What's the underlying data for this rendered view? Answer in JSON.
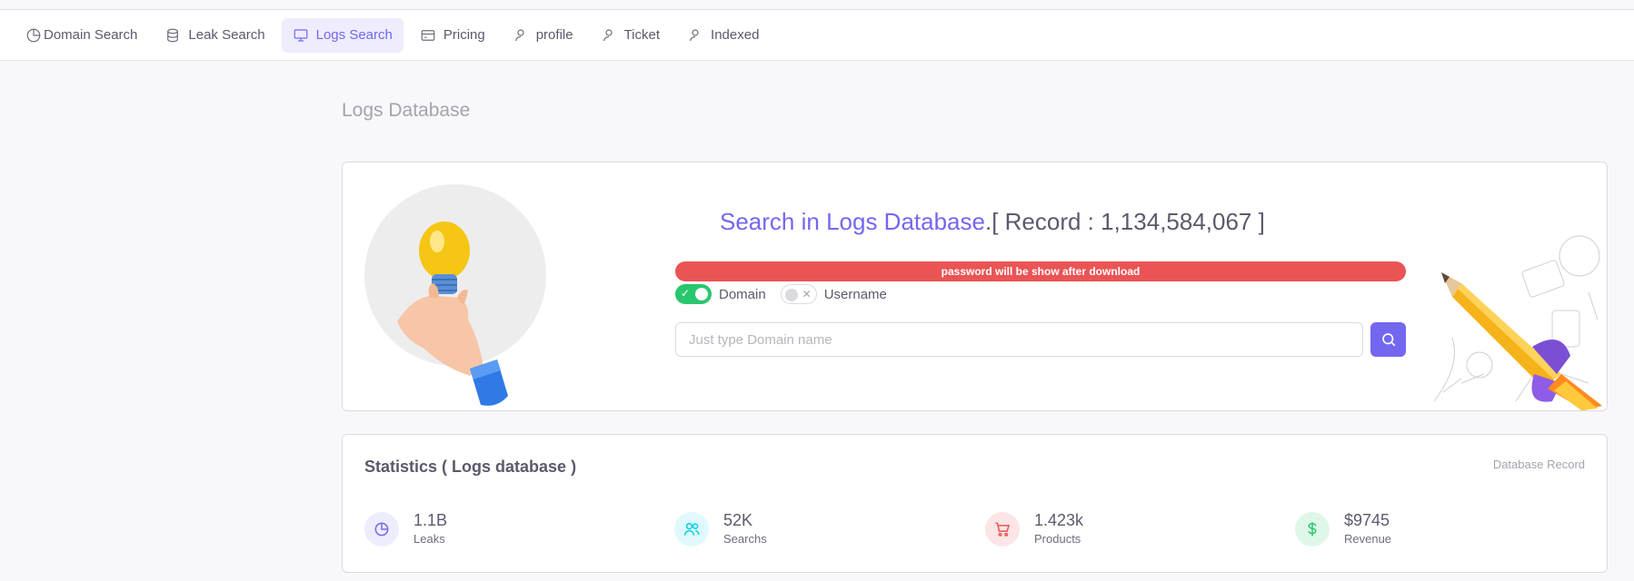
{
  "nav": {
    "items": [
      {
        "label": "Domain Search",
        "icon": "pie-chart-icon",
        "active": false
      },
      {
        "label": "Leak Search",
        "icon": "database-icon",
        "active": false
      },
      {
        "label": "Logs Search",
        "icon": "monitor-icon",
        "active": true
      },
      {
        "label": "Pricing",
        "icon": "credit-card-icon",
        "active": false
      },
      {
        "label": "profile",
        "icon": "user-icon",
        "active": false
      },
      {
        "label": "Ticket",
        "icon": "user-icon",
        "active": false
      },
      {
        "label": "Indexed",
        "icon": "user-icon",
        "active": false
      }
    ]
  },
  "page": {
    "title": "Logs Database"
  },
  "hero": {
    "title_accent": "Search in Logs Database",
    "title_rest": ".[ Record : 1,134,584,067 ]",
    "alert": "password will be show after download",
    "toggles": [
      {
        "label": "Domain",
        "checked": true
      },
      {
        "label": "Username",
        "checked": false
      }
    ],
    "search_placeholder": "Just type Domain name",
    "search_value": ""
  },
  "stats": {
    "title": "Statistics ( Logs database )",
    "meta": "Database Record",
    "items": [
      {
        "value": "1.1B",
        "label": "Leaks",
        "icon": "pie-chart-icon",
        "color": "#7367f0",
        "bg": "#eeedfd"
      },
      {
        "value": "52K",
        "label": "Searchs",
        "icon": "users-icon",
        "color": "#00cfe8",
        "bg": "#e0f9fc"
      },
      {
        "value": "1.423k",
        "label": "Products",
        "icon": "shopping-cart-icon",
        "color": "#ea5455",
        "bg": "#fce5e6"
      },
      {
        "value": "$9745",
        "label": "Revenue",
        "icon": "dollar-icon",
        "color": "#28c76f",
        "bg": "#dff7e9"
      }
    ]
  },
  "colors": {
    "primary": "#7367f0",
    "danger": "#ea5455",
    "success": "#28c76f",
    "info": "#00cfe8"
  }
}
